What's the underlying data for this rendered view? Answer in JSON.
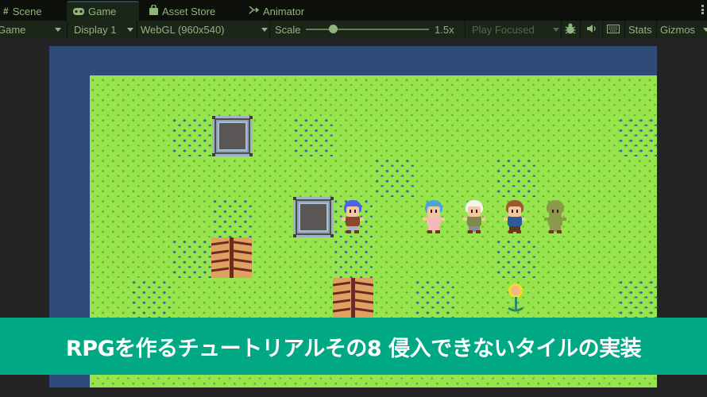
{
  "tabs": [
    {
      "label": "Scene",
      "icon": "grid-hash-icon",
      "glyph": "#",
      "active": false
    },
    {
      "label": "Game",
      "icon": "gamepad-icon",
      "glyph": "",
      "active": true
    },
    {
      "label": "Asset Store",
      "icon": "shopping-bag-icon",
      "glyph": "",
      "active": false
    },
    {
      "label": "Animator",
      "icon": "animator-icon",
      "glyph": "⤚",
      "active": false
    }
  ],
  "toolbar": {
    "view_mode": "Game",
    "display": "Display 1",
    "resolution": "WebGL (960x540)",
    "scale_label": "Scale",
    "scale_value_text": "1.5x",
    "scale_fraction": 0.22,
    "play_mode": "Play Focused",
    "stats_label": "Stats",
    "gizmos_label": "Gizmos"
  },
  "colors": {
    "toolbar_text": "#8fb47e",
    "frame_blue": "#2f4b7a",
    "grass": "#98e44c",
    "tall_grass": "#1f6aa8",
    "banner": "#00a884"
  },
  "scene": {
    "characters": [
      {
        "name": "player",
        "hair": "#4a63e8",
        "body": "#8a4a2a",
        "legs": "#a6b4c8"
      },
      {
        "name": "girl",
        "hair": "#4aa6d8",
        "body": "#f4b8b8",
        "legs": "#f4b8b8"
      },
      {
        "name": "old-man",
        "hair": "#f4f4ee",
        "body": "#7e8a4a",
        "legs": "#8a8aa0"
      },
      {
        "name": "boy",
        "hair": "#9a5a30",
        "body": "#2a5a9a",
        "legs": "#5a3a20"
      },
      {
        "name": "goblin",
        "hair": "#8a9a4a",
        "body": "#8a9a4a",
        "legs": "#8a9a4a"
      }
    ]
  },
  "banner": {
    "title": "RPGを作るチュートリアルその8 侵入できないタイルの実装"
  }
}
